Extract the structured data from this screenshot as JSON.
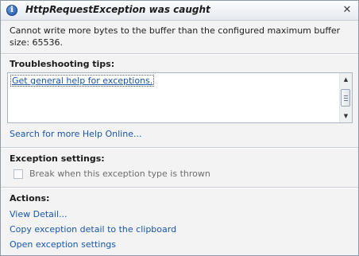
{
  "dialog": {
    "title": "HttpRequestException was caught",
    "close_glyph": "✕",
    "info_glyph": "i",
    "message": "Cannot write more bytes to the buffer than the configured maximum buffer size: 65536."
  },
  "troubleshooting": {
    "label": "Troubleshooting tips:",
    "tips": [
      "Get general help for exceptions."
    ],
    "search_link": "Search for more Help Online..."
  },
  "exception_settings": {
    "label": "Exception settings:",
    "checkbox_label": "Break when this exception type is thrown",
    "checked": false
  },
  "actions": {
    "label": "Actions:",
    "items": [
      "View Detail...",
      "Copy exception detail to the clipboard",
      "Open exception settings"
    ]
  },
  "icons": {
    "info": "info-icon",
    "close": "close-icon",
    "scroll_up": "scroll-up-icon",
    "scroll_down": "scroll-down-icon"
  },
  "colors": {
    "link": "#1a56a8",
    "background": "#f3f3f3",
    "border": "#8e9aa8"
  }
}
